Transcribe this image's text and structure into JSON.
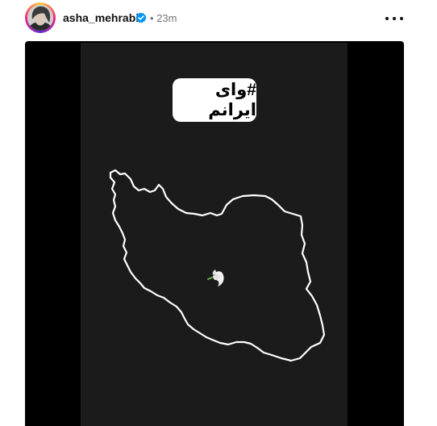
{
  "post": {
    "username": "asha_mehrabi",
    "verified": true,
    "separator": "•",
    "time": "23m",
    "more_icon": "more-horizontal-icon"
  },
  "media": {
    "hashtag": "#وای ایرانم",
    "map_icon": "iran-map-outline",
    "dove_icon": "peace-dove-icon",
    "colors": {
      "outer_background": "#000000",
      "panel_background": "#1b1b1b",
      "outline": "#ffffff"
    }
  }
}
